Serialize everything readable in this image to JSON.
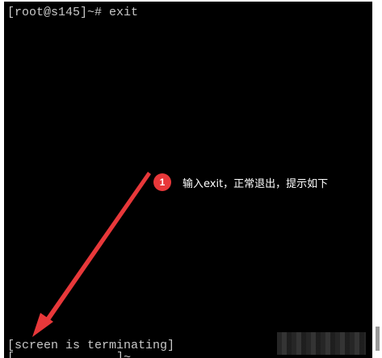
{
  "terminal": {
    "prompt_line": "[root@s145]~# exit",
    "status_line": "[screen is terminating]",
    "partial_line": "[              ]~"
  },
  "annotation": {
    "step_number": "1",
    "text": "输入exit，正常退出，提示如下"
  },
  "colors": {
    "background": "#000000",
    "terminal_text": "#c8c8c8",
    "annotation_accent": "#e8383a"
  }
}
